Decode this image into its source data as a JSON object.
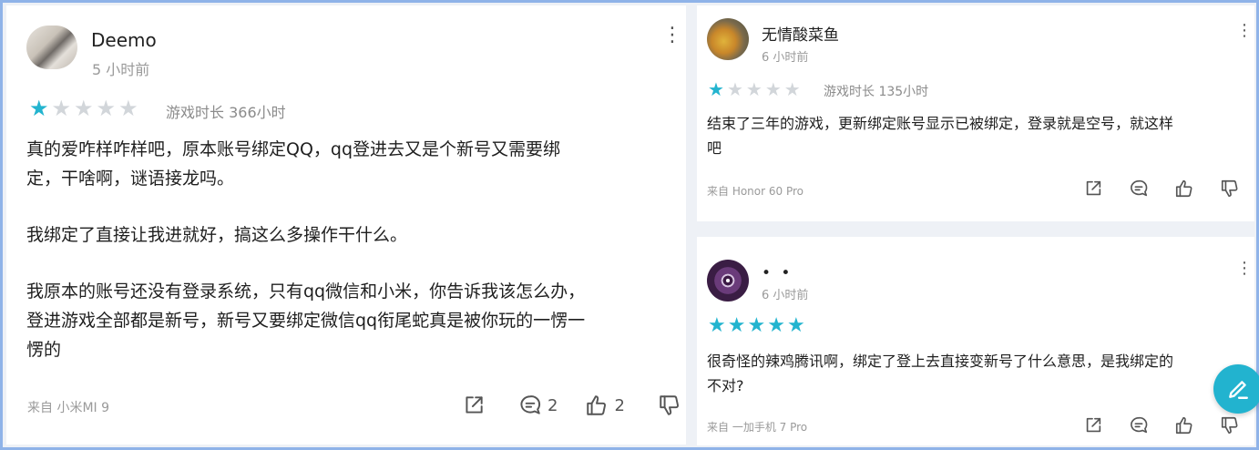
{
  "reviews": [
    {
      "user": "Deemo",
      "time": "5 小时前",
      "rating": 1,
      "playtime": "游戏时长 366小时",
      "lines": [
        "真的爱咋样咋样吧，原本账号绑定QQ，qq登进去又是个新号又需要绑",
        "定，干啥啊，谜语接龙吗。",
        "",
        "我绑定了直接让我进就好，搞这么多操作干什么。",
        "",
        "我原本的账号还没有登录系统，只有qq微信和小米，你告诉我该怎么办，",
        "登进游戏全部都是新号，新号又要绑定微信qq衔尾蛇真是被你玩的一愣一",
        "愣的"
      ],
      "device": "来自 小米MI 9",
      "comments": "2",
      "likes": "2"
    },
    {
      "user": "无情酸菜鱼",
      "time": "6 小时前",
      "rating": 1,
      "playtime": "游戏时长 135小时",
      "lines": [
        "结束了三年的游戏，更新绑定账号显示已被绑定，登录就是空号，就这样",
        "吧"
      ],
      "device": "来自 Honor 60 Pro"
    },
    {
      "user": "• •",
      "time": "6 小时前",
      "rating": 5,
      "lines": [
        "很奇怪的辣鸡腾讯啊，绑定了登上去直接变新号了什么意思，是我绑定的",
        "不对?"
      ],
      "device": "来自 一加手机 7 Pro"
    }
  ],
  "icons": {
    "share": "share-icon",
    "comment": "comment-icon",
    "like": "thumbs-up-icon",
    "dislike": "thumbs-down-icon",
    "more": "more-vertical-icon",
    "edit": "pencil-icon"
  },
  "colors": {
    "star_on": "#23b4cf",
    "star_off": "#d2d6da",
    "fab": "#22b3cf"
  }
}
